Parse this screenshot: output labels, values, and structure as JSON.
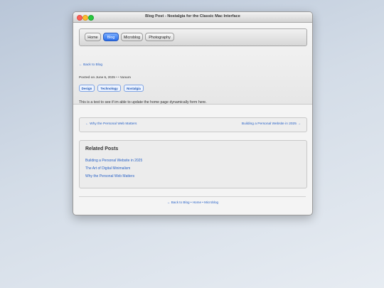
{
  "window": {
    "title": "Blog Post - Nostalgia for the Classic Mac Interface"
  },
  "nav": {
    "items": [
      {
        "label": "Home",
        "active": false
      },
      {
        "label": "Blog",
        "active": true
      },
      {
        "label": "Microblog",
        "active": false
      },
      {
        "label": "Photography",
        "active": false
      }
    ]
  },
  "post": {
    "back_link": "← Back to Blog",
    "meta": "Posted on June 6, 2025 • • Vanum",
    "tags": [
      "Design",
      "Technology",
      "Nostalgia"
    ],
    "body": "This is a test to see if im able to update the home page dynamically form here."
  },
  "post_nav": {
    "prev": "← Why the Personal Web Matters",
    "next": "Building a Personal Website in 2025 →"
  },
  "related": {
    "heading": "Related Posts",
    "links": [
      "Building a Personal Website in 2025",
      "The Art of Digital Minimalism",
      "Why the Personal Web Matters"
    ]
  },
  "footer": {
    "text": "← Back to Blog • Home • Microblog"
  }
}
